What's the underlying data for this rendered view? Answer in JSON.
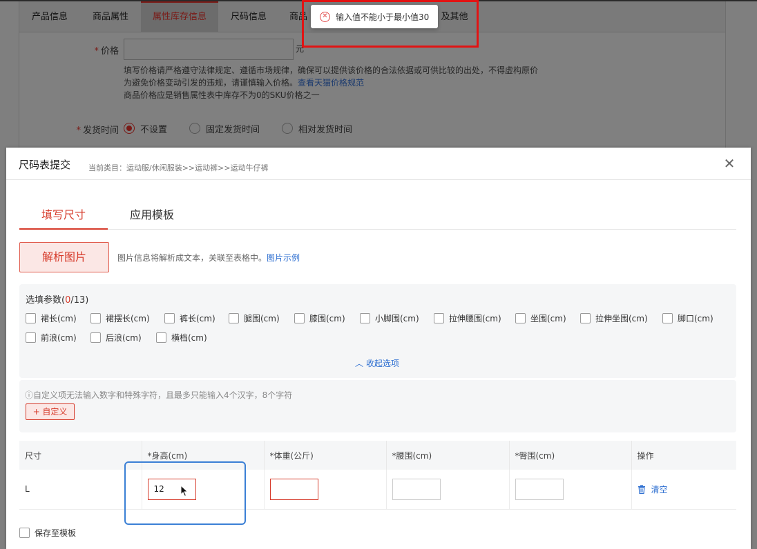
{
  "bg": {
    "tabs": [
      "产品信息",
      "商品属性",
      "属性库存信息",
      "尺码信息",
      "商品",
      "及其他"
    ],
    "price_label": "价格",
    "price_unit": "元",
    "price_note_1": "填写价格请严格遵守法律规定、遵循市场规律，确保可以提供该价格的合法依据或可供比较的出处，不得虚构原价",
    "price_note_2_prefix": "为避免价格变动引发的违规，请谨慎输入价格。",
    "price_note_2_link": "查看天猫价格规范",
    "price_note_3": "商品价格应是销售属性表中库存不为0的SKU价格之一",
    "ship_label": "发货时间",
    "ship_options": [
      "不设置",
      "固定发货时间",
      "相对发货时间"
    ]
  },
  "toast": {
    "message": "输入值不能小于最小值30"
  },
  "modal": {
    "title": "尺码表提交",
    "crumb": "当前类目：运动服/休闲服装>>运动裤>>运动牛仔裤",
    "close_glyph": "✕",
    "tabs": [
      "填写尺寸",
      "应用模板"
    ],
    "parse_button": "解析图片",
    "parse_hint": "图片信息将解析成文本，关联至表格中。",
    "parse_hint_link": "图片示例",
    "params_title_prefix": "选填参数(",
    "params_selected": "0",
    "params_title_suffix": "/13)",
    "params": [
      "裙长(cm)",
      "裙摆长(cm)",
      "裤长(cm)",
      "腿围(cm)",
      "膝围(cm)",
      "小脚围(cm)",
      "拉伸腰围(cm)",
      "坐围(cm)",
      "拉伸坐围(cm)",
      "脚口(cm)",
      "前浪(cm)",
      "后浪(cm)",
      "横档(cm)"
    ],
    "collapse_link": "收起选项",
    "custom_hint": "ⓘ自定义项无法输入数字和特殊字符，且最多只能输入4个汉字，8个字符",
    "custom_button": "+ 自定义",
    "table": {
      "headers": [
        "尺寸",
        "*身高(cm)",
        "*体重(公斤)",
        "*腰围(cm)",
        "*臀围(cm)",
        "操作"
      ],
      "row_size": "L",
      "height_value": "12",
      "weight_value": "",
      "waist_value": "",
      "hip_value": "",
      "clear_label": "清空"
    },
    "save_template": "保存至模板"
  },
  "colors": {
    "accent": "#d63a2a",
    "link": "#2e6fd1",
    "highlight_red": "#e21313",
    "highlight_blue": "#3a7fd5"
  }
}
